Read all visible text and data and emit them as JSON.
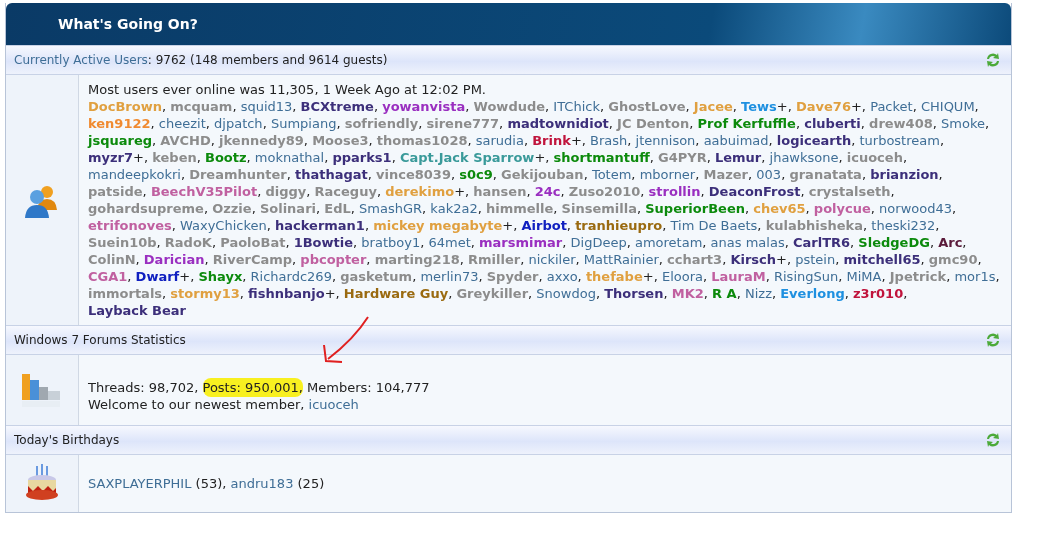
{
  "title": "What's Going On?",
  "separator": ",",
  "active_users": {
    "link": "Currently Active Users",
    "summary": ": 9762 (148 members and 9614 guests)",
    "record": "Most users ever online was 11,305, 1 Week Ago at 12:02 PM.",
    "users": [
      {
        "name": "DocBrown",
        "color": "#e0a040",
        "bold": true
      },
      {
        "name": "mcquam",
        "color": "#8c8c8c",
        "bold": true
      },
      {
        "name": "squid13",
        "color": "#3f6e96",
        "bold": false
      },
      {
        "name": "BCXtreme",
        "color": "#3c2f7a",
        "bold": true
      },
      {
        "name": "yowanvista",
        "color": "#9a2fc0",
        "bold": true
      },
      {
        "name": "Wowdude",
        "color": "#8c8c8c",
        "bold": true
      },
      {
        "name": "ITChick",
        "color": "#3f6e96",
        "bold": false
      },
      {
        "name": "GhostLove",
        "color": "#8c8c8c",
        "bold": true
      },
      {
        "name": "Jacee",
        "color": "#e0a040",
        "bold": true
      },
      {
        "name": "Tews",
        "color": "#1e90e0",
        "bold": true,
        "suffix": "+"
      },
      {
        "name": "Dave76",
        "color": "#e0a040",
        "bold": true,
        "suffix": "+"
      },
      {
        "name": "Packet",
        "color": "#3f6e96",
        "bold": false
      },
      {
        "name": "CHIQUM",
        "color": "#3f6e96",
        "bold": false
      },
      {
        "name": "ken9122",
        "color": "#f08a30",
        "bold": true
      },
      {
        "name": "cheezit",
        "color": "#3f6e96",
        "bold": false
      },
      {
        "name": "djpatch",
        "color": "#3f6e96",
        "bold": false
      },
      {
        "name": "Sumpiang",
        "color": "#3f6e96",
        "bold": false
      },
      {
        "name": "sofriendly",
        "color": "#8c8c8c",
        "bold": true
      },
      {
        "name": "sirene777",
        "color": "#8c8c8c",
        "bold": true
      },
      {
        "name": "madtownidiot",
        "color": "#3c2f7a",
        "bold": true
      },
      {
        "name": "JC Denton",
        "color": "#8c8c8c",
        "bold": true
      },
      {
        "name": "Prof Kerfuffle",
        "color": "#0c8a0c",
        "bold": true
      },
      {
        "name": "cluberti",
        "color": "#3c2f7a",
        "bold": true
      },
      {
        "name": "drew408",
        "color": "#8c8c8c",
        "bold": true
      },
      {
        "name": "Smoke",
        "color": "#3f6e96",
        "bold": false
      },
      {
        "name": "jsquareg",
        "color": "#0c8a0c",
        "bold": true
      },
      {
        "name": "AVCHD",
        "color": "#8c8c8c",
        "bold": true
      },
      {
        "name": "jkennedy89",
        "color": "#8c8c8c",
        "bold": true
      },
      {
        "name": "Moose3",
        "color": "#8c8c8c",
        "bold": true
      },
      {
        "name": "thomas1028",
        "color": "#8c8c8c",
        "bold": true
      },
      {
        "name": "sarudia",
        "color": "#3f6e96",
        "bold": false
      },
      {
        "name": "Brink",
        "color": "#c0143c",
        "bold": true,
        "suffix": "+"
      },
      {
        "name": "Brash",
        "color": "#3f6e96",
        "bold": false
      },
      {
        "name": "jtennison",
        "color": "#3f6e96",
        "bold": false
      },
      {
        "name": "aabuimad",
        "color": "#3f6e96",
        "bold": false
      },
      {
        "name": "logicearth",
        "color": "#3c2f7a",
        "bold": true
      },
      {
        "name": "turbostream",
        "color": "#3f6e96",
        "bold": false
      },
      {
        "name": "myzr7",
        "color": "#3c2f7a",
        "bold": true,
        "suffix": "+"
      },
      {
        "name": "keben",
        "color": "#8c8c8c",
        "bold": true
      },
      {
        "name": "Bootz",
        "color": "#0c8a0c",
        "bold": true
      },
      {
        "name": "moknathal",
        "color": "#3f6e96",
        "bold": false
      },
      {
        "name": "pparks1",
        "color": "#3c2f7a",
        "bold": true
      },
      {
        "name": "Capt.Jack Sparrow",
        "color": "#3a9a9a",
        "bold": true,
        "suffix": "+"
      },
      {
        "name": "shortmantuff",
        "color": "#0c8a0c",
        "bold": true
      },
      {
        "name": "G4PYR",
        "color": "#8c8c8c",
        "bold": true
      },
      {
        "name": "Lemur",
        "color": "#3c2f7a",
        "bold": true
      },
      {
        "name": "jhawksone",
        "color": "#3f6e96",
        "bold": false
      },
      {
        "name": "icuoceh",
        "color": "#8c8c8c",
        "bold": true
      },
      {
        "name": "mandeepkokri",
        "color": "#3f6e96",
        "bold": false
      },
      {
        "name": "Dreamhunter",
        "color": "#8c8c8c",
        "bold": true
      },
      {
        "name": "thathagat",
        "color": "#3c2f7a",
        "bold": true
      },
      {
        "name": "vince8039",
        "color": "#8c8c8c",
        "bold": true
      },
      {
        "name": "s0c9",
        "color": "#0c8a0c",
        "bold": true
      },
      {
        "name": "Gekijouban",
        "color": "#8c8c8c",
        "bold": true
      },
      {
        "name": "Totem",
        "color": "#3f6e96",
        "bold": false
      },
      {
        "name": "mborner",
        "color": "#3f6e96",
        "bold": false
      },
      {
        "name": "Mazer",
        "color": "#8c8c8c",
        "bold": true
      },
      {
        "name": "003",
        "color": "#3f6e96",
        "bold": false
      },
      {
        "name": "granatata",
        "color": "#8c8c8c",
        "bold": true
      },
      {
        "name": "brianzion",
        "color": "#3c2f7a",
        "bold": true
      },
      {
        "name": "patside",
        "color": "#8c8c8c",
        "bold": true
      },
      {
        "name": "BeechV35Pilot",
        "color": "#c060a0",
        "bold": true
      },
      {
        "name": "diggy",
        "color": "#8c8c8c",
        "bold": true
      },
      {
        "name": "Raceguy",
        "color": "#8c8c8c",
        "bold": true
      },
      {
        "name": "derekimo",
        "color": "#e0a040",
        "bold": true,
        "suffix": "+"
      },
      {
        "name": "hansen",
        "color": "#8c8c8c",
        "bold": true
      },
      {
        "name": "24c",
        "color": "#9a2fc0",
        "bold": true
      },
      {
        "name": "Zuso2010",
        "color": "#8c8c8c",
        "bold": true
      },
      {
        "name": "strollin",
        "color": "#9a2fc0",
        "bold": true
      },
      {
        "name": "DeaconFrost",
        "color": "#3c2f7a",
        "bold": true
      },
      {
        "name": "crystalseth",
        "color": "#8c8c8c",
        "bold": true
      },
      {
        "name": "gohardsupreme",
        "color": "#8c8c8c",
        "bold": true
      },
      {
        "name": "Ozzie",
        "color": "#8c8c8c",
        "bold": true
      },
      {
        "name": "Solinari",
        "color": "#8c8c8c",
        "bold": true
      },
      {
        "name": "EdL",
        "color": "#8c8c8c",
        "bold": true
      },
      {
        "name": "SmashGR",
        "color": "#3f6e96",
        "bold": false
      },
      {
        "name": "kak2a2",
        "color": "#3f6e96",
        "bold": false
      },
      {
        "name": "himmelle",
        "color": "#8c8c8c",
        "bold": true
      },
      {
        "name": "Sinsemilla",
        "color": "#8c8c8c",
        "bold": true
      },
      {
        "name": "SuperiorBeen",
        "color": "#0c8a0c",
        "bold": true
      },
      {
        "name": "chev65",
        "color": "#e0a040",
        "bold": true
      },
      {
        "name": "polycue",
        "color": "#c060a0",
        "bold": true
      },
      {
        "name": "norwood43",
        "color": "#3f6e96",
        "bold": false
      },
      {
        "name": "etrifonoves",
        "color": "#c060a0",
        "bold": true
      },
      {
        "name": "WaxyChicken",
        "color": "#3f6e96",
        "bold": false
      },
      {
        "name": "hackerman1",
        "color": "#3c2f7a",
        "bold": true
      },
      {
        "name": "mickey megabyte",
        "color": "#e0a040",
        "bold": true,
        "suffix": "+"
      },
      {
        "name": "Airbot",
        "color": "#1020c0",
        "bold": true
      },
      {
        "name": "tranhieupro",
        "color": "#9a6a10",
        "bold": true
      },
      {
        "name": "Tim De Baets",
        "color": "#3f6e96",
        "bold": false
      },
      {
        "name": "kulabhisheka",
        "color": "#8c8c8c",
        "bold": true
      },
      {
        "name": "theski232",
        "color": "#3f6e96",
        "bold": false
      },
      {
        "name": "Suein10b",
        "color": "#8c8c8c",
        "bold": true
      },
      {
        "name": "RadoK",
        "color": "#8c8c8c",
        "bold": true
      },
      {
        "name": "PaoloBat",
        "color": "#8c8c8c",
        "bold": true
      },
      {
        "name": "1Bowtie",
        "color": "#3c2f7a",
        "bold": true
      },
      {
        "name": "bratboy1",
        "color": "#3f6e96",
        "bold": false
      },
      {
        "name": "64met",
        "color": "#3f6e96",
        "bold": false
      },
      {
        "name": "marsmimar",
        "color": "#9a2fc0",
        "bold": true
      },
      {
        "name": "DigDeep",
        "color": "#3f6e96",
        "bold": false
      },
      {
        "name": "amoretam",
        "color": "#3f6e96",
        "bold": false
      },
      {
        "name": "anas malas",
        "color": "#3f6e96",
        "bold": false
      },
      {
        "name": "CarlTR6",
        "color": "#3c2f7a",
        "bold": true
      },
      {
        "name": "SledgeDG",
        "color": "#0c8a0c",
        "bold": true
      },
      {
        "name": "Arc",
        "color": "#5a1a3a",
        "bold": true
      },
      {
        "name": "ColinN",
        "color": "#8c8c8c",
        "bold": true
      },
      {
        "name": "Darician",
        "color": "#9a2fc0",
        "bold": true
      },
      {
        "name": "RiverCamp",
        "color": "#8c8c8c",
        "bold": true
      },
      {
        "name": "pbcopter",
        "color": "#c060a0",
        "bold": true
      },
      {
        "name": "marting218",
        "color": "#8c8c8c",
        "bold": true
      },
      {
        "name": "Rmiller",
        "color": "#8c8c8c",
        "bold": true
      },
      {
        "name": "nickiler",
        "color": "#3f6e96",
        "bold": false
      },
      {
        "name": "MattRainier",
        "color": "#3f6e96",
        "bold": false
      },
      {
        "name": "cchart3",
        "color": "#8c8c8c",
        "bold": true
      },
      {
        "name": "Kirsch",
        "color": "#3c2f7a",
        "bold": true,
        "suffix": "+"
      },
      {
        "name": "pstein",
        "color": "#3f6e96",
        "bold": false
      },
      {
        "name": "mitchell65",
        "color": "#3c2f7a",
        "bold": true
      },
      {
        "name": "gmc90",
        "color": "#8c8c8c",
        "bold": true
      },
      {
        "name": "CGA1",
        "color": "#c060a0",
        "bold": true
      },
      {
        "name": "Dwarf",
        "color": "#1020c0",
        "bold": true,
        "suffix": "+"
      },
      {
        "name": "Shayx",
        "color": "#0c8a0c",
        "bold": true
      },
      {
        "name": "Richardc269",
        "color": "#3f6e96",
        "bold": false
      },
      {
        "name": "gasketum",
        "color": "#8c8c8c",
        "bold": true
      },
      {
        "name": "merlin73",
        "color": "#3f6e96",
        "bold": false
      },
      {
        "name": "Spyder",
        "color": "#8c8c8c",
        "bold": true
      },
      {
        "name": "axxo",
        "color": "#3f6e96",
        "bold": false
      },
      {
        "name": "thefabe",
        "color": "#e0a040",
        "bold": true,
        "suffix": "+"
      },
      {
        "name": "Eloora",
        "color": "#3f6e96",
        "bold": false
      },
      {
        "name": "LauraM",
        "color": "#c060a0",
        "bold": true
      },
      {
        "name": "RisingSun",
        "color": "#3f6e96",
        "bold": false
      },
      {
        "name": "MiMA",
        "color": "#3f6e96",
        "bold": false
      },
      {
        "name": "Jpetrick",
        "color": "#8c8c8c",
        "bold": true
      },
      {
        "name": "mor1s",
        "color": "#3f6e96",
        "bold": false
      },
      {
        "name": "immortals",
        "color": "#8c8c8c",
        "bold": true
      },
      {
        "name": "stormy13",
        "color": "#e0a040",
        "bold": true
      },
      {
        "name": "fishnbanjo",
        "color": "#3c2f7a",
        "bold": true,
        "suffix": "+"
      },
      {
        "name": "Hardware Guy",
        "color": "#9a6a10",
        "bold": true
      },
      {
        "name": "Greykiller",
        "color": "#8c8c8c",
        "bold": true
      },
      {
        "name": "Snowdog",
        "color": "#3f6e96",
        "bold": false
      },
      {
        "name": "Thorsen",
        "color": "#3c2f7a",
        "bold": true
      },
      {
        "name": "MK2",
        "color": "#c060a0",
        "bold": true
      },
      {
        "name": "R A",
        "color": "#0c8a0c",
        "bold": true
      },
      {
        "name": "Nizz",
        "color": "#3f6e96",
        "bold": false
      },
      {
        "name": "Everlong",
        "color": "#1e90e0",
        "bold": true
      },
      {
        "name": "z3r010",
        "color": "#c0143c",
        "bold": true
      },
      {
        "name": "Layback Bear",
        "color": "#3c2f7a",
        "bold": true
      }
    ]
  },
  "statistics": {
    "title": "Windows 7 Forums Statistics",
    "parts": [
      {
        "text": "Threads: 98,702,",
        "highlighted": false
      },
      {
        "text": "Posts: 950,001,",
        "highlighted": true
      },
      {
        "text": "Members: 104,777",
        "highlighted": false
      }
    ],
    "welcome": "Welcome to our newest member,",
    "newest_member": "icuoceh"
  },
  "birthdays": {
    "title": "Today's Birthdays",
    "people": [
      {
        "name": "SAXPLAYERPHIL",
        "age": "(53)"
      },
      {
        "name": "andru183",
        "age": "(25)"
      }
    ]
  }
}
